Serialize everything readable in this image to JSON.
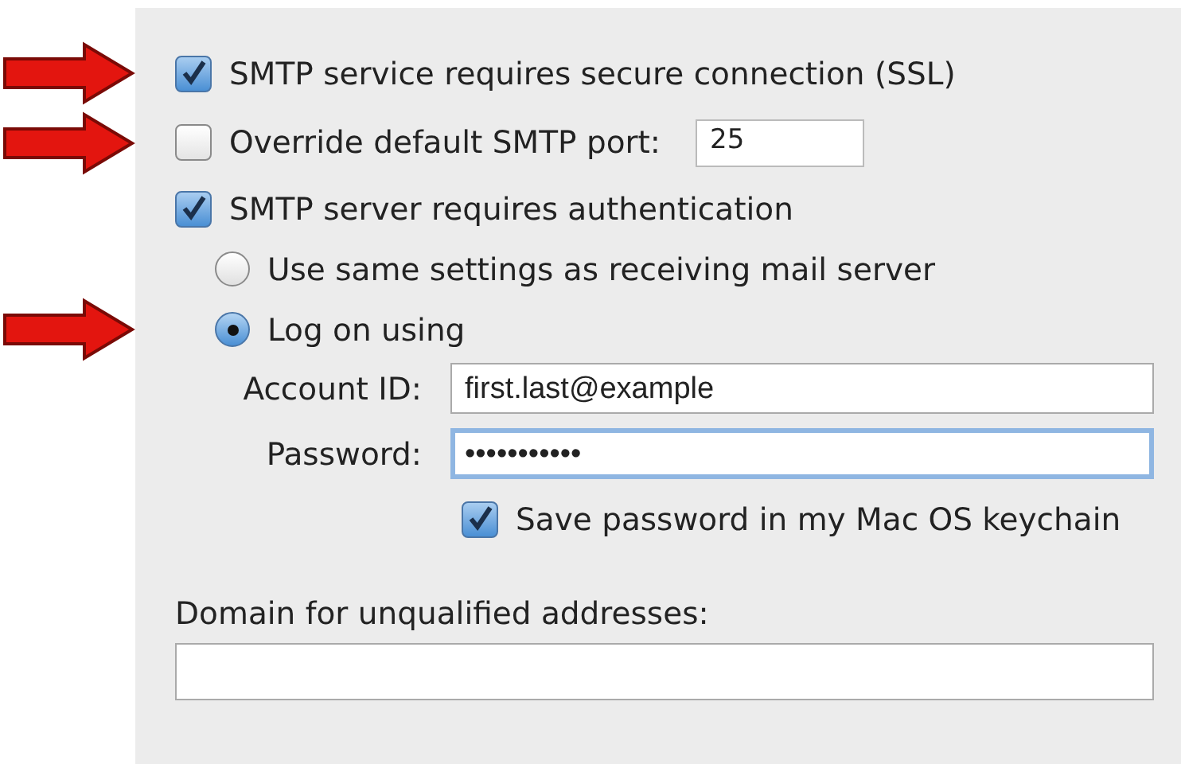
{
  "options": [
    {
      "kind": "checkbox",
      "label": "SMTP service requires secure connection (SSL)",
      "checked": true,
      "marked": true
    },
    {
      "kind": "checkbox",
      "label": "Override default SMTP port:",
      "checked": false,
      "marked": true,
      "field_value": "25"
    },
    {
      "kind": "checkbox",
      "label": "SMTP server requires authentication",
      "checked": true,
      "marked": false
    }
  ],
  "logon_choices": [
    {
      "label": "Use same settings as receiving mail server",
      "selected": false,
      "marked": false
    },
    {
      "label": "Log on using",
      "selected": true,
      "marked": true
    }
  ],
  "credentials": [
    {
      "label": "Account ID:",
      "value": "first.last@example",
      "focused": false
    },
    {
      "label": "Password:",
      "value": "•••••••••••",
      "focused": true
    }
  ],
  "save_password": {
    "label": "Save password in my Mac OS keychain",
    "checked": true
  },
  "domain": {
    "label": "Domain for unqualified addresses:"
  }
}
